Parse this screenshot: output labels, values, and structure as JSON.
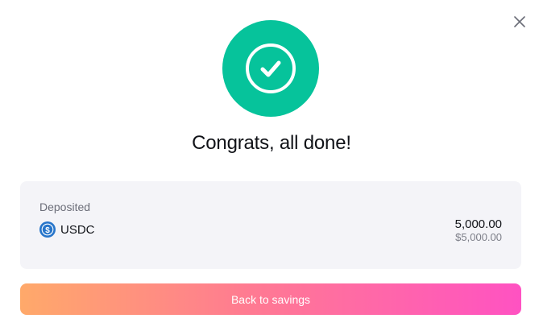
{
  "modal": {
    "close_icon": "close-icon",
    "success_icon": "check-circle-icon",
    "success_color": "#06c39b",
    "title": "Congrats, all done!"
  },
  "summary": {
    "label": "Deposited",
    "asset": {
      "icon": "usdc-coin-icon",
      "icon_color": "#2775ca",
      "name": "USDC"
    },
    "amount": "5,000.00",
    "amount_usd": "$5,000.00"
  },
  "actions": {
    "back_label": "Back to savings",
    "gradient_start": "#ffa96a",
    "gradient_end": "#ff52c2"
  }
}
